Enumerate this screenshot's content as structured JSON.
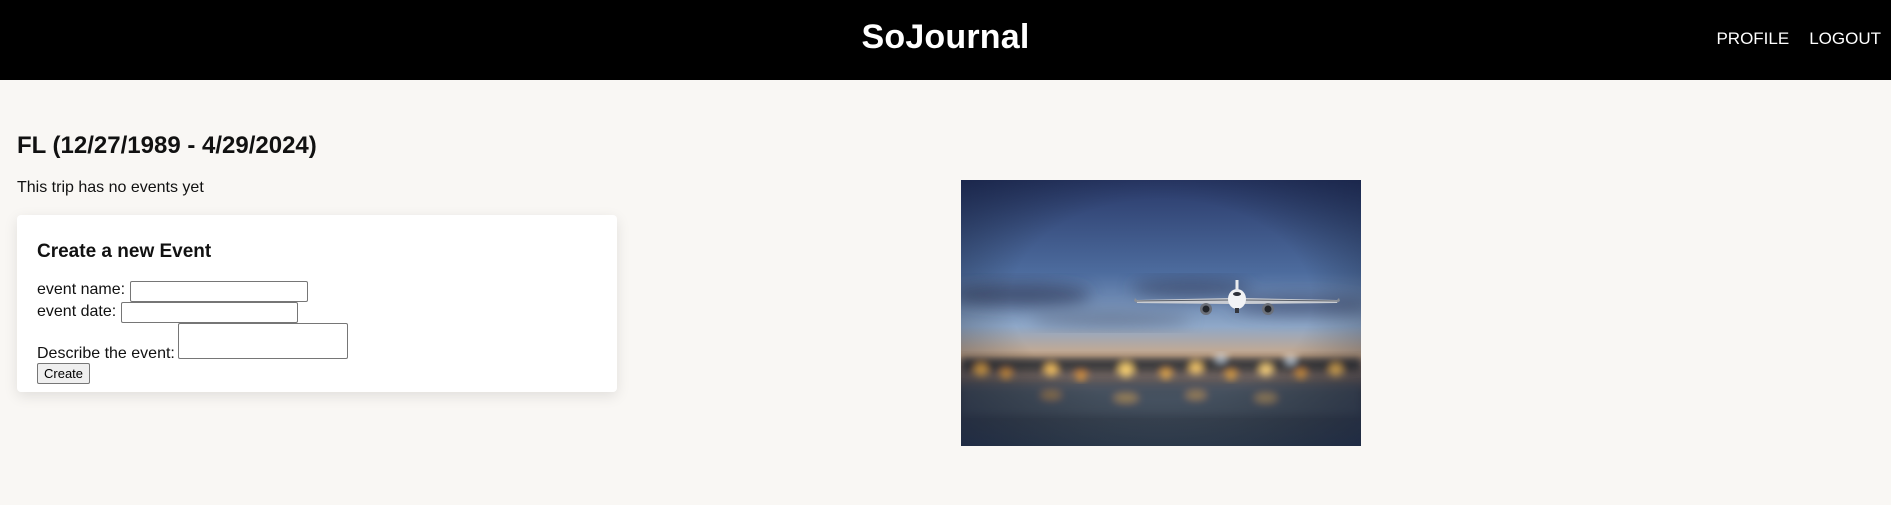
{
  "header": {
    "brand": "SoJournal",
    "nav": {
      "profile": "PROFILE",
      "logout": "LOGOUT"
    }
  },
  "trip": {
    "title": "FL (12/27/1989 - 4/29/2024)",
    "empty_message": "This trip has no events yet"
  },
  "event_form": {
    "title": "Create a new Event",
    "name_label": "event name:",
    "name_value": "",
    "date_label": "event date:",
    "date_value": "",
    "description_label": "Describe the event:",
    "description_value": "",
    "submit_label": "Create"
  },
  "photo": {
    "subject": "airplane-in-flight-at-dusk"
  },
  "colors": {
    "header_bg": "#000000",
    "page_bg": "#f9f7f4",
    "card_bg": "#ffffff"
  }
}
